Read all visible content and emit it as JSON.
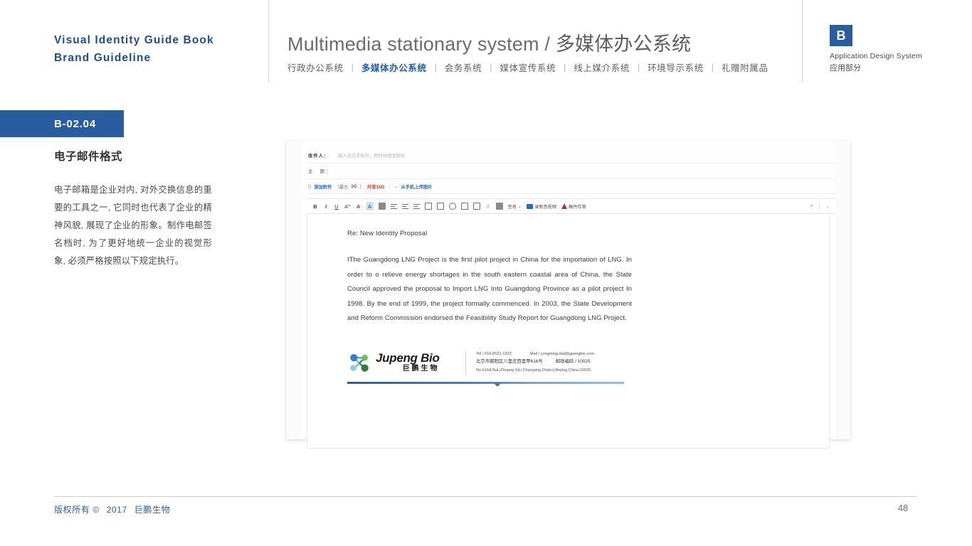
{
  "brand": {
    "line1": "Visual  Identity  Guide  Book",
    "line2": "Brand  Guideline"
  },
  "header": {
    "title_en": "Multimedia stationary system",
    "title_sep": "/",
    "title_cn": "多媒体办公系统",
    "nav": [
      {
        "label": "行政办公系统",
        "active": false
      },
      {
        "label": "多媒体办公系统",
        "active": true
      },
      {
        "label": "会务系统",
        "active": false
      },
      {
        "label": "媒体宣传系统",
        "active": false
      },
      {
        "label": "线上媒介系统",
        "active": false
      },
      {
        "label": "环境导示系统",
        "active": false
      },
      {
        "label": "礼赠附属品",
        "active": false
      }
    ],
    "nav_separator": "|"
  },
  "badge": {
    "letter": "B",
    "caption_en": "Application Design System",
    "caption_cn": "应用部分",
    "color": "#2a5ca0"
  },
  "section": {
    "code": "B-02.04",
    "heading": "电子邮件格式",
    "body": "电子邮箱是企业对内, 对外交换信息的重要的工具之一, 它同时也代表了企业的精神风貌, 展现了企业的形象。制作电邮签名档时, 为了更好地统一企业的视觉形象, 必须严格按照以下规定执行。"
  },
  "mail": {
    "fields": {
      "to_label": "收件人：",
      "to_placeholder": "输入对方手机号，即时给他发邮件",
      "subject_label": "主　题：",
      "subject_value": ""
    },
    "attachment_bar": {
      "clip_icon": "paperclip-icon",
      "add_attachment": "添加附件",
      "max_note_prefix": "（最大",
      "max_note_size": "3G",
      "max_note_suffix": "）",
      "upgrade": "升至15G",
      "divider": "|",
      "chevron": "⌄",
      "from_phone": "从手机上传图片"
    },
    "toolbar": {
      "bold": "B",
      "italic": "I",
      "underline": "U",
      "font_size": "A^",
      "font_color": "A",
      "highlight": "A",
      "clear_format": "clear-format-icon",
      "align": "align-icon",
      "bullet_list": "bullet-list-icon",
      "indent": "indent-icon",
      "insert_image": "image-icon",
      "screenshot": "screenshot-icon",
      "emoji": "emoji-icon",
      "insert_card": "card-icon",
      "calendar": "calendar-icon",
      "voice": "microphone-icon",
      "template": "template-icon",
      "signature_label": "签名",
      "signature_caret": "⌄",
      "record_label": "录制音视频",
      "draft_label": "稿件存草",
      "expand_icon": "expand-icon",
      "more_icon": "chevron-down-icon"
    },
    "subject_line": "Re: New Identity Proposal",
    "paragraph": "IThe Guangdong LNG Project is the first pilot project in China for the importation of LNG. In order to o relieve energy shortages in the south eastern coastal area of China, the State Council approved the proposal to Import LNG Into Guangdong Province as a pilot project In 1998.  By the end of 1999, the project formally commenced. In 2003, the State Development and Reform Commission endorsed the Feasibility Study Report for Guangdong LNG Project."
  },
  "signature": {
    "name_en": "Jupeng Bio",
    "name_cn": "巨鹏生物",
    "tel": "Tel / 010-6521-1323",
    "mail": "Mail / yongming.dai@jupengbio.com",
    "address_cn": "北京市朝阳区八里庄西里甲616号",
    "postcode_cn": "邮政编码 / 10025",
    "address_en": "No.616A BaLiZhuang XiLi,Chaoyang District,Beijing,China,10025",
    "rule_color": "#2e5f96"
  },
  "footer": {
    "copyright": "版权所有 ©",
    "year": "2017",
    "company": "巨鹏生物",
    "page_number": "48"
  }
}
